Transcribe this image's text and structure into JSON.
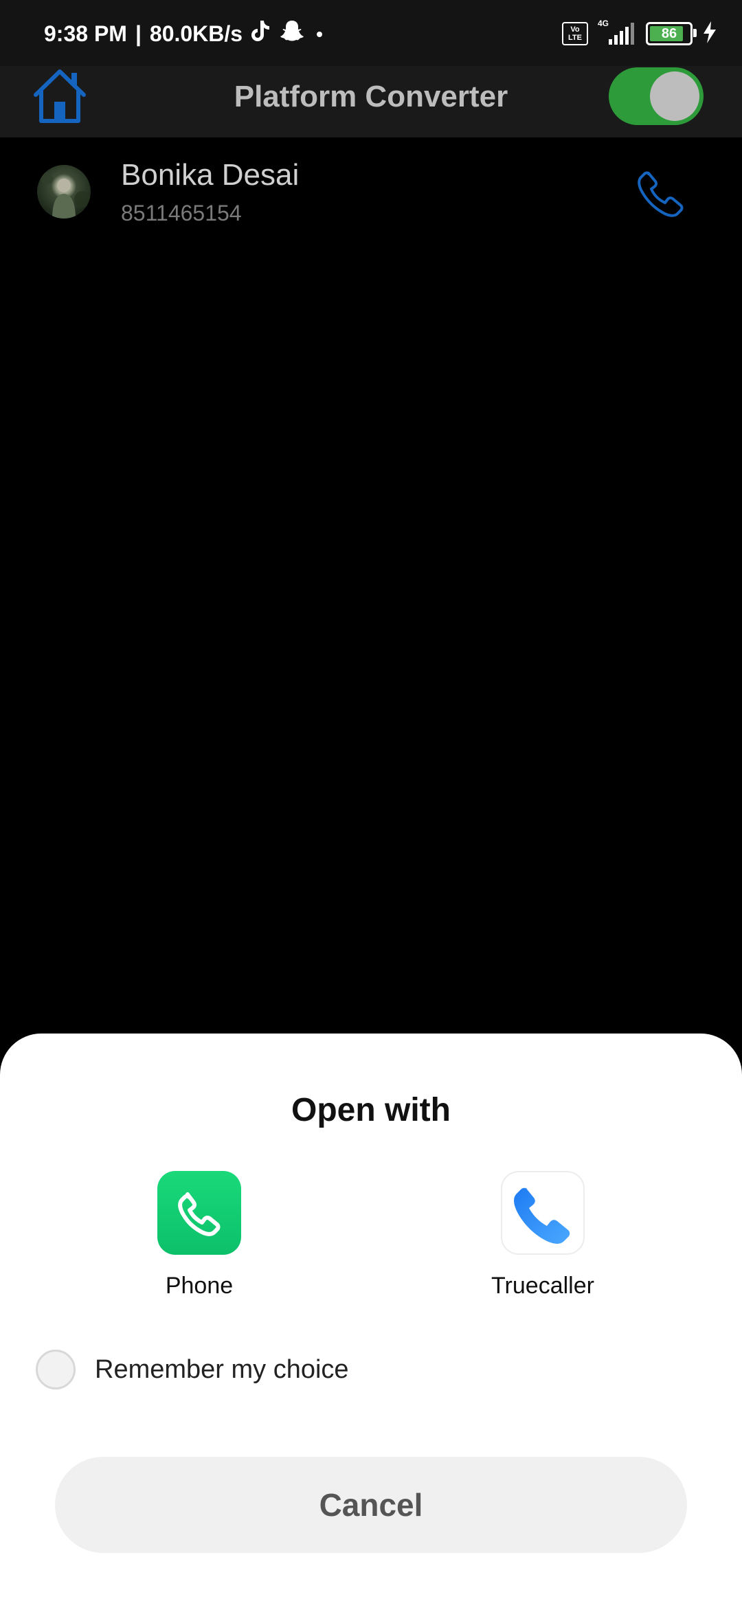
{
  "status_bar": {
    "time": "9:38 PM",
    "separator": "|",
    "network_speed": "80.0KB/s",
    "volte_top": "Vo",
    "volte_bottom": "LTE",
    "network_type": "4G",
    "battery_level": "86"
  },
  "app_bar": {
    "title": "Platform Converter",
    "toggle_on": true,
    "accent_color": "#1565c0",
    "toggle_color": "#2e9b3a"
  },
  "contact": {
    "name": "Bonika Desai",
    "number": "8511465154"
  },
  "sheet": {
    "title": "Open with",
    "apps": [
      {
        "label": "Phone",
        "icon": "phone-app-icon"
      },
      {
        "label": "Truecaller",
        "icon": "truecaller-app-icon"
      }
    ],
    "remember_label": "Remember my choice",
    "remember_checked": false,
    "cancel_label": "Cancel"
  }
}
